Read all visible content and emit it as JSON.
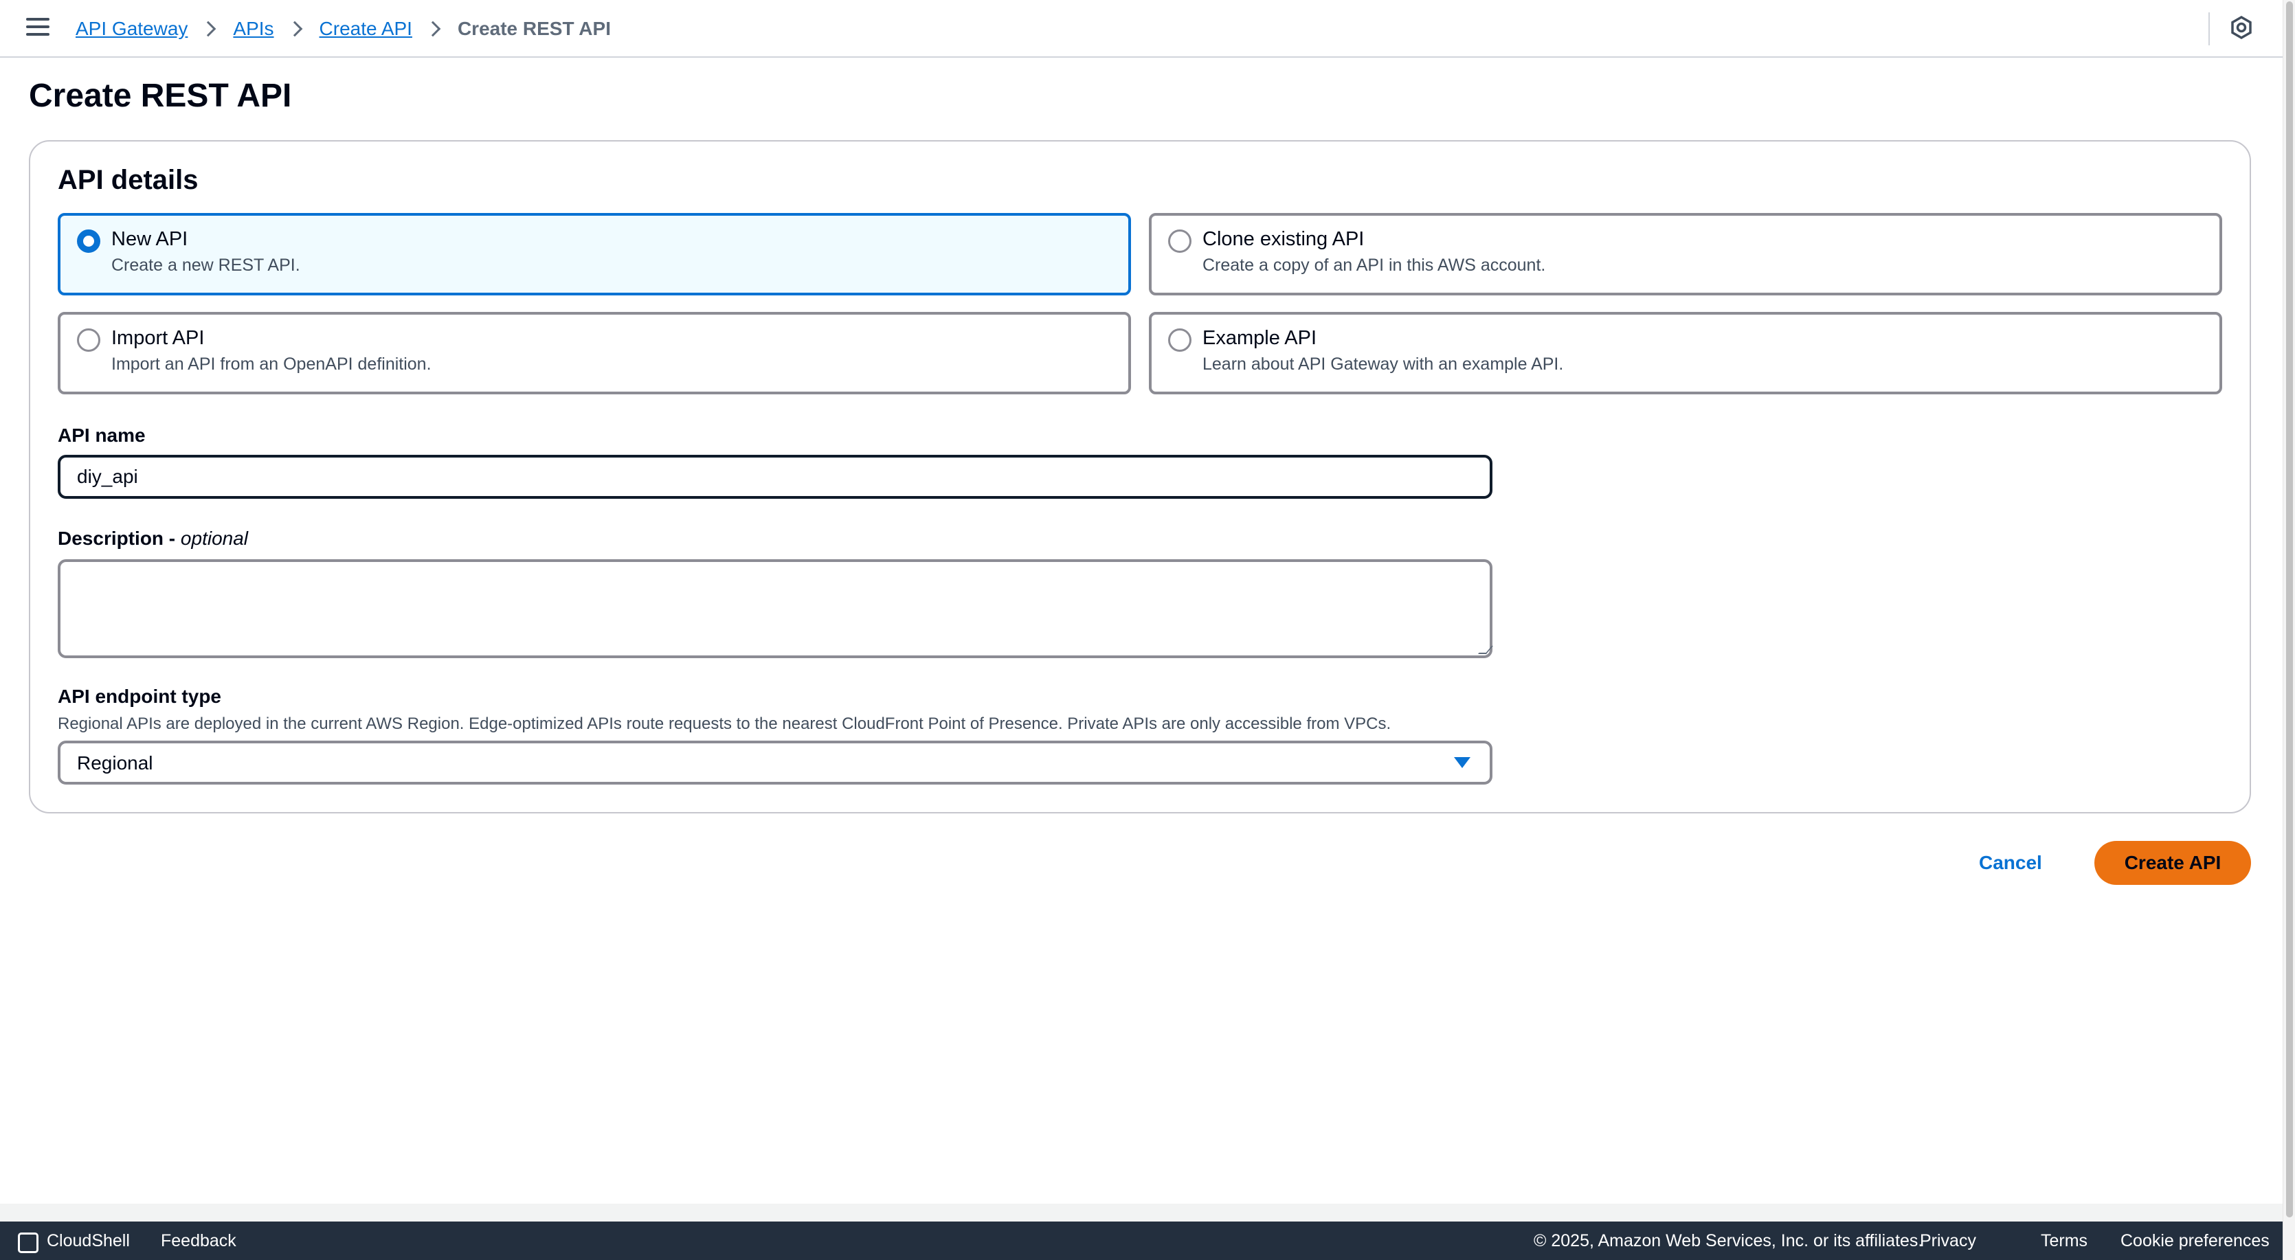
{
  "breadcrumb": {
    "items": [
      "API Gateway",
      "APIs",
      "Create API"
    ],
    "current": "Create REST API"
  },
  "page": {
    "title": "Create REST API"
  },
  "api_details": {
    "title": "API details",
    "options": [
      {
        "label": "New API",
        "description": "Create a new REST API.",
        "selected": true
      },
      {
        "label": "Clone existing API",
        "description": "Create a copy of an API in this AWS account.",
        "selected": false
      },
      {
        "label": "Import API",
        "description": "Import an API from an OpenAPI definition.",
        "selected": false
      },
      {
        "label": "Example API",
        "description": "Learn about API Gateway with an example API.",
        "selected": false
      }
    ]
  },
  "form": {
    "api_name_label": "API name",
    "api_name_value": "diy_api",
    "description_label": "Description -",
    "description_optional": "optional",
    "description_value": "",
    "endpoint_label": "API endpoint type",
    "endpoint_description": "Regional APIs are deployed in the current AWS Region. Edge-optimized APIs route requests to the nearest CloudFront Point of Presence. Private APIs are only accessible from VPCs.",
    "endpoint_value": "Regional"
  },
  "actions": {
    "cancel": "Cancel",
    "create": "Create API"
  },
  "footer": {
    "cloudshell": "CloudShell",
    "feedback": "Feedback",
    "copyright": "© 2025, Amazon Web Services, Inc. or its affiliates.",
    "privacy": "Privacy",
    "terms": "Terms",
    "cookie": "Cookie preferences"
  },
  "colors": {
    "link": "#0972d3",
    "primary_button": "#ec7211",
    "footer_bg": "#232f3e"
  }
}
